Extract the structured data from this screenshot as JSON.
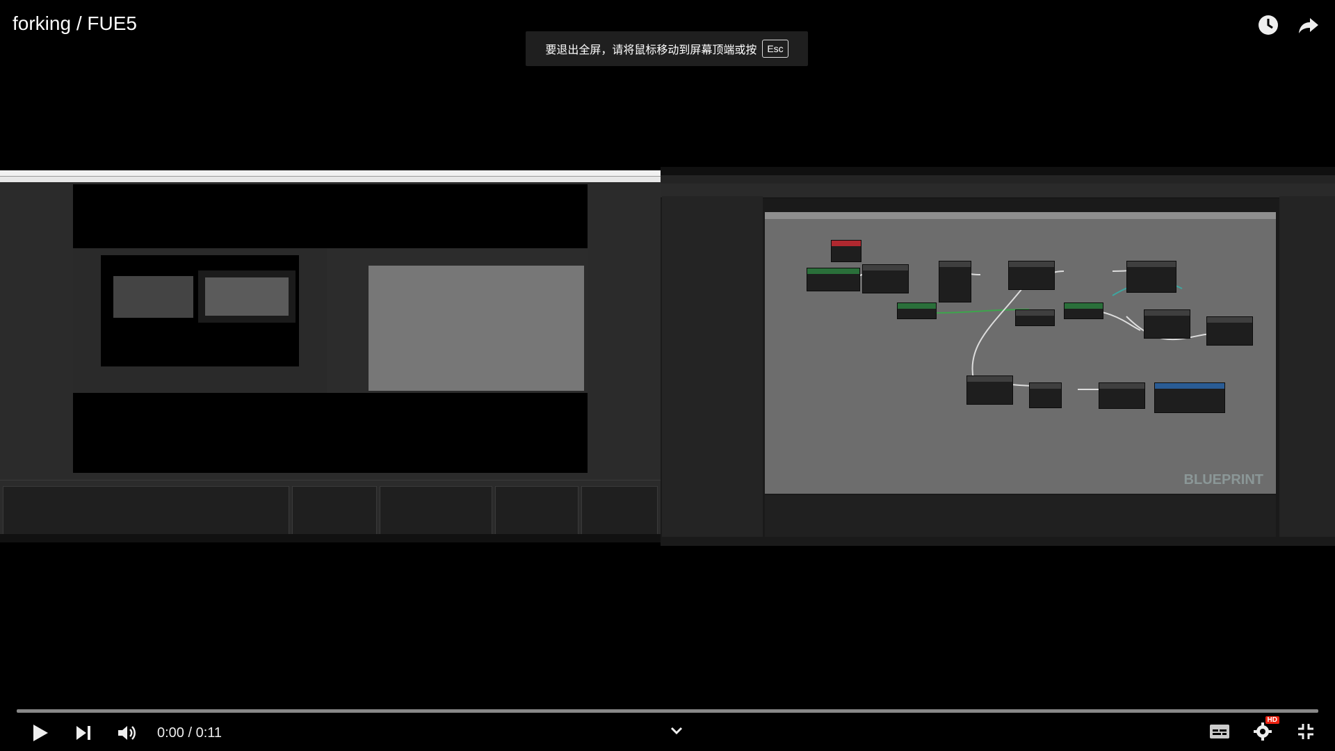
{
  "player": {
    "title": "forking / FUE5",
    "fullscreen_notice": "要退出全屏，请将鼠标移动到屏幕顶端或按",
    "esc_key": "Esc",
    "time": "0:00 / 0:11",
    "progress_fraction": 0.0,
    "quality_badge": "HD"
  },
  "ue": {
    "watermark": "BLUEPRINT"
  },
  "icons": {
    "watch_later": "clock-icon",
    "share": "share-icon",
    "play": "play-icon",
    "next": "next-icon",
    "volume": "volume-icon",
    "expand": "chevron-down-icon",
    "subtitles": "subtitles-icon",
    "settings": "gear-icon",
    "exit_fullscreen": "exit-fullscreen-icon"
  },
  "colors": {
    "background": "#000000",
    "toast": "#1f1f1f",
    "progress_played": "#ff0000",
    "ue_graph": "#6d6d6d"
  }
}
